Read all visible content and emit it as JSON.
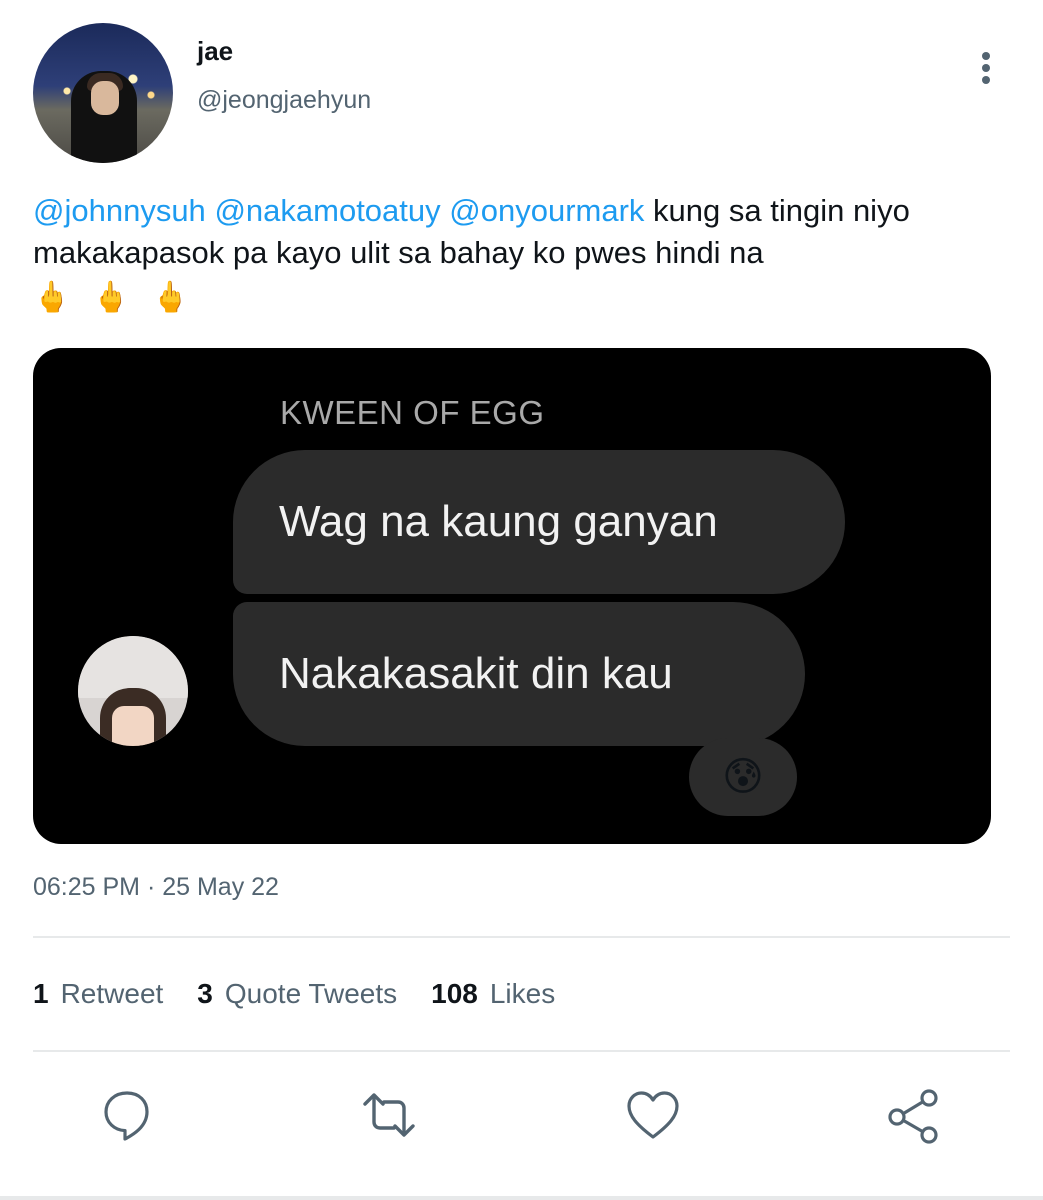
{
  "author": {
    "name": "jae",
    "handle": "@jeongjaehyun"
  },
  "tweet": {
    "mentions": [
      "@johnnysuh",
      "@nakamotoatuy",
      "@onyourmark"
    ],
    "text": " kung sa tingin niyo makakapasok pa kayo ulit sa bahay ko pwes hindi na",
    "emojis": [
      "🖕",
      "🖕",
      "🖕"
    ]
  },
  "media": {
    "chat_name": "KWEEN OF EGG",
    "messages": [
      "Wag na kaung ganyan",
      "Nakakasakit din kau"
    ],
    "reaction": "😰"
  },
  "timestamp": "06:25 PM · 25 May 22",
  "stats": {
    "retweets_count": "1",
    "retweets_label": "Retweet",
    "quotes_count": "3",
    "quotes_label": "Quote Tweets",
    "likes_count": "108",
    "likes_label": "Likes"
  },
  "icons": {
    "more": "more-vertical-icon",
    "reply": "reply-icon",
    "retweet": "retweet-icon",
    "like": "like-icon",
    "share": "share-icon"
  },
  "colors": {
    "accent": "#1d9bf0",
    "secondary_text": "#536471",
    "icon": "#536471"
  }
}
